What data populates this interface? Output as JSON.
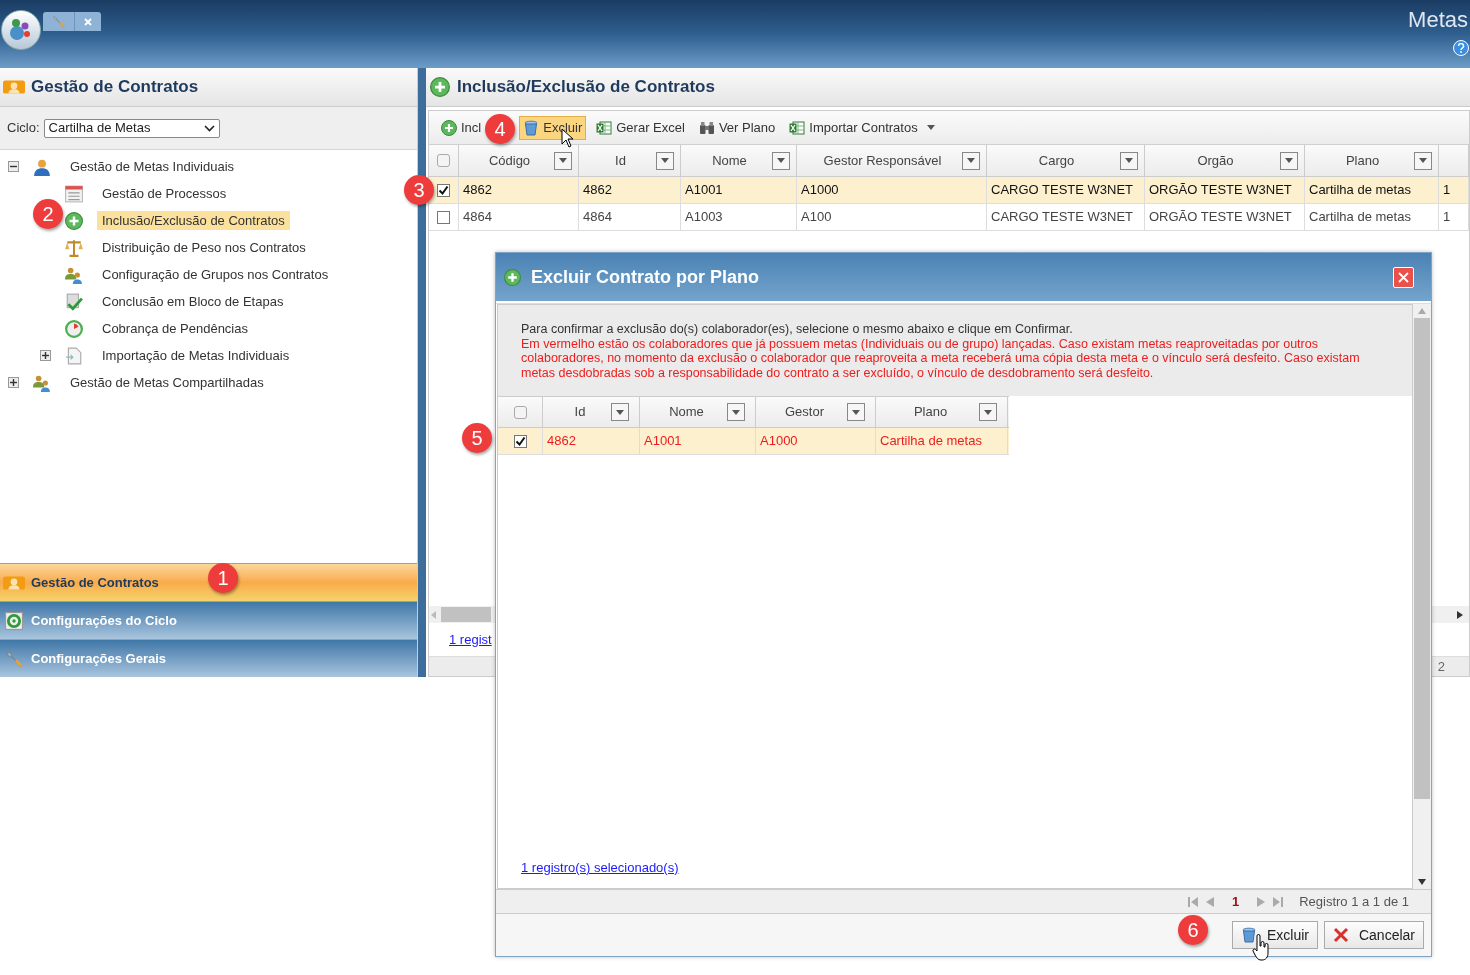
{
  "app_bar": {
    "title": "Metas"
  },
  "left_panel": {
    "title": "Gestão de Contratos",
    "cycle": {
      "label": "Ciclo:",
      "value": "Cartilha de Metas"
    },
    "tree": [
      {
        "label": "Gestão de Metas Individuais",
        "kind": "folder",
        "expanded": true,
        "selected": false,
        "children": [
          {
            "label": "Gestão de Processos",
            "kind": "leaf",
            "selected": false
          },
          {
            "label": "Inclusão/Exclusão de Contratos",
            "kind": "leaf",
            "selected": true
          },
          {
            "label": "Distribuição de Peso nos Contratos",
            "kind": "leaf",
            "selected": false
          },
          {
            "label": "Configuração de Grupos nos Contratos",
            "kind": "leaf",
            "selected": false
          },
          {
            "label": "Conclusão em Bloco de Etapas",
            "kind": "leaf",
            "selected": false
          },
          {
            "label": "Cobrança de Pendências",
            "kind": "leaf",
            "selected": false
          },
          {
            "label": "Importação de Metas Individuais",
            "kind": "folder",
            "expanded": false,
            "selected": false
          }
        ]
      },
      {
        "label": "Gestão de Metas Compartilhadas",
        "kind": "folder",
        "expanded": false,
        "selected": false
      }
    ],
    "accordion": [
      {
        "label": "Gestão de Contratos",
        "selected": true
      },
      {
        "label": "Configurações do Ciclo",
        "selected": false
      },
      {
        "label": "Configurações Gerais",
        "selected": false
      }
    ]
  },
  "main_panel": {
    "title": "Inclusão/Exclusão de Contratos",
    "toolbar": [
      {
        "label": "Incl",
        "selected": false
      },
      {
        "label": "Excluir",
        "selected": true
      },
      {
        "label": "Gerar Excel",
        "selected": false
      },
      {
        "label": "Ver Plano",
        "selected": false
      },
      {
        "label": "Importar Contratos",
        "selected": false,
        "dropdown": true
      }
    ],
    "table": {
      "all_checked": false,
      "columns": [
        "Código",
        "Id",
        "Nome",
        "Gestor Responsável",
        "Cargo",
        "Orgão",
        "Plano",
        ""
      ],
      "rows": [
        {
          "checked": true,
          "selected": true,
          "cells": [
            "4862",
            "4862",
            "A1001",
            "A1000",
            "CARGO TESTE W3NET",
            "ORGÃO TESTE W3NET",
            "Cartilha de metas",
            "1"
          ]
        },
        {
          "checked": false,
          "selected": false,
          "cells": [
            "4864",
            "4864",
            "A1003",
            "A100",
            "CARGO TESTE W3NET",
            "ORGÃO TESTE W3NET",
            "Cartilha de metas",
            "1"
          ]
        }
      ]
    },
    "selection_link": "1 regist",
    "pager_text": "2"
  },
  "dialog": {
    "title": "Excluir Contrato por Plano",
    "message": "Para confirmar a exclusão do(s) colaborador(es), selecione o mesmo abaixo e clique em Confirmar.",
    "warning": "Em vermelho estão os colaboradores que já possuem metas (Individuais ou de grupo) lançadas. Caso existam metas reaproveitadas por outros colaboradores, no momento da exclusão o colaborador que reaproveita a meta receberá uma cópia desta meta e o vínculo será desfeito. Caso existam metas desdobradas sob a responsabilidade do contrato a ser excluído, o vínculo de desdobramento será desfeito.",
    "table": {
      "all_checked": false,
      "columns": [
        "Id",
        "Nome",
        "Gestor",
        "Plano"
      ],
      "rows": [
        {
          "checked": true,
          "selected": true,
          "alert": true,
          "cells": [
            "4862",
            "A1001",
            "A1000",
            "Cartilha de metas"
          ]
        }
      ]
    },
    "selection_link": "1 registro(s) selecionado(s)",
    "pager": {
      "page": "1",
      "summary": "Registro 1 a 1 de 1"
    },
    "buttons": [
      "Excluir",
      "Cancelar"
    ]
  },
  "callouts": [
    "1",
    "2",
    "3",
    "4",
    "5",
    "6"
  ]
}
